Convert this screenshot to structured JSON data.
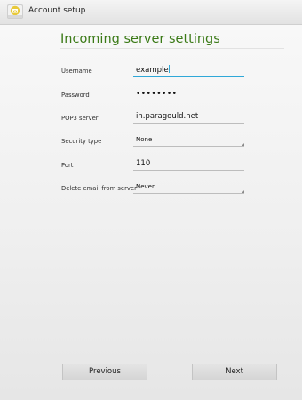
{
  "actionbar": {
    "title": "Account setup",
    "icon": "email-app-icon"
  },
  "page": {
    "title": "Incoming server settings"
  },
  "form": {
    "username": {
      "label": "Username",
      "value": "example"
    },
    "password": {
      "label": "Password",
      "value": "••••••••"
    },
    "pop3_server": {
      "label": "POP3 server",
      "value": "in.paragould.net"
    },
    "security_type": {
      "label": "Security type",
      "value": "None"
    },
    "port": {
      "label": "Port",
      "value": "110"
    },
    "delete_email": {
      "label": "Delete email from server",
      "value": "Never"
    }
  },
  "buttons": {
    "previous": "Previous",
    "next": "Next"
  },
  "colors": {
    "title_green": "#3b7a17",
    "focus_blue": "#2fa8d8",
    "icon_yellow": "#e8c93a"
  }
}
